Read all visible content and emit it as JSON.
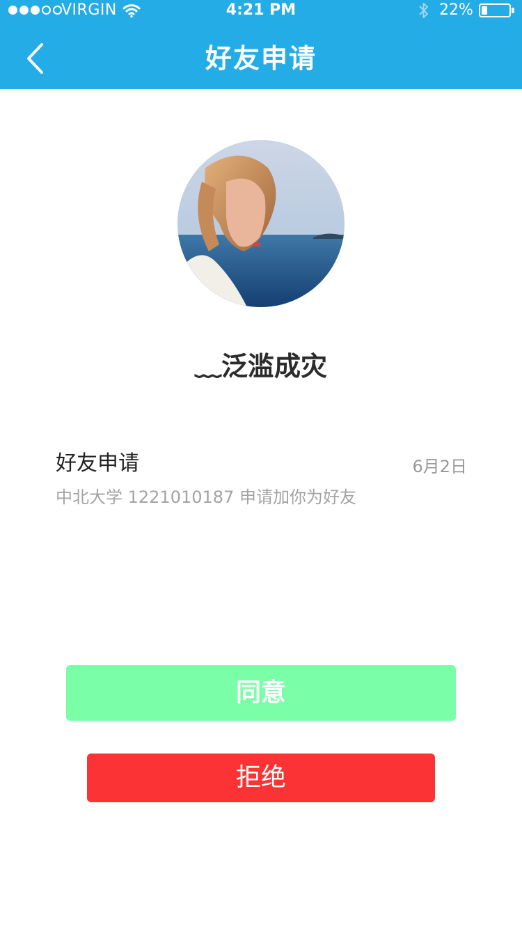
{
  "status_bar": {
    "carrier": "VIRGIN",
    "time": "4:21 PM",
    "battery_percent": "22%",
    "battery_level": 0.22,
    "signal_strength": 3,
    "signal_max": 5
  },
  "nav": {
    "title": "好友申请"
  },
  "profile": {
    "username": "﹏泛滥成灾"
  },
  "request": {
    "title": "好友申请",
    "date": "6月2日",
    "description": "中北大学 1221010187 申请加你为好友"
  },
  "actions": {
    "accept_label": "同意",
    "reject_label": "拒绝"
  },
  "colors": {
    "nav_bg": "#23ace5",
    "accept_bg": "#7afea8",
    "reject_bg": "#fc3334"
  }
}
